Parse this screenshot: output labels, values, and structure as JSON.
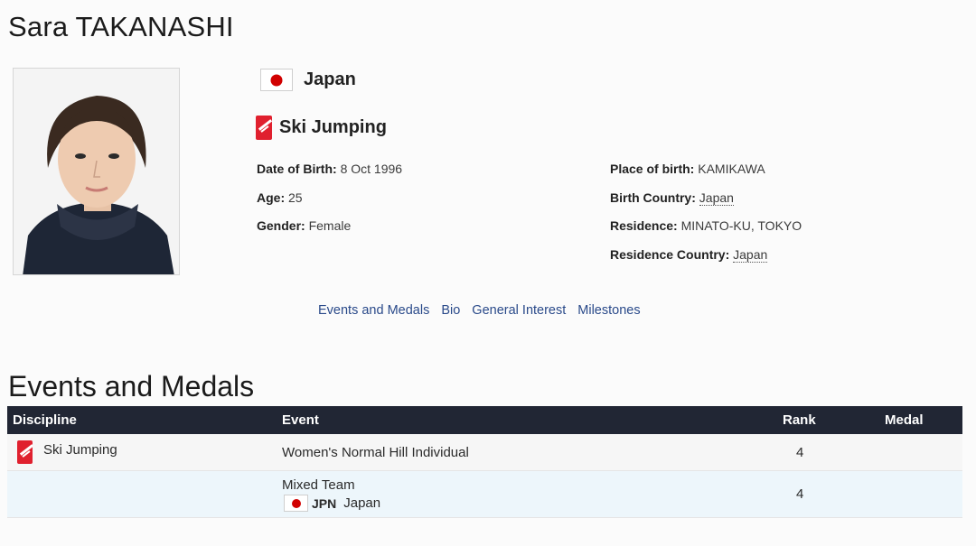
{
  "athlete": {
    "name": "Sara TAKANASHI",
    "country": "Japan",
    "sport": "Ski Jumping",
    "details_left": [
      {
        "label": "Date of Birth:",
        "value": "8 Oct 1996"
      },
      {
        "label": "Age:",
        "value": "25"
      },
      {
        "label": "Gender:",
        "value": "Female"
      }
    ],
    "details_right": [
      {
        "label": "Place of birth:",
        "value": "KAMIKAWA"
      },
      {
        "label": "Birth Country:",
        "value": "Japan"
      },
      {
        "label": "Residence:",
        "value": "MINATO-KU, TOKYO"
      },
      {
        "label": "Residence Country:",
        "value": "Japan"
      }
    ]
  },
  "subnav": [
    "Events and Medals",
    "Bio",
    "General Interest",
    "Milestones"
  ],
  "events": {
    "title": "Events and Medals",
    "headers": {
      "discipline": "Discipline",
      "event": "Event",
      "rank": "Rank",
      "medal": "Medal"
    },
    "rows": [
      {
        "discipline": "Ski Jumping",
        "event": "Women's Normal Hill Individual",
        "rank": "4",
        "medal": ""
      },
      {
        "discipline": "",
        "event": "Mixed Team",
        "team_code": "JPN",
        "team_country": "Japan",
        "rank": "4",
        "medal": ""
      }
    ]
  },
  "colors": {
    "header_bg": "#212634",
    "link": "#2a4a8a",
    "flag_red": "#d10000",
    "sport_icon": "#e0202e"
  },
  "icons": {
    "country_flag": "japan-flag-icon",
    "sport": "ski-jumping-icon"
  }
}
